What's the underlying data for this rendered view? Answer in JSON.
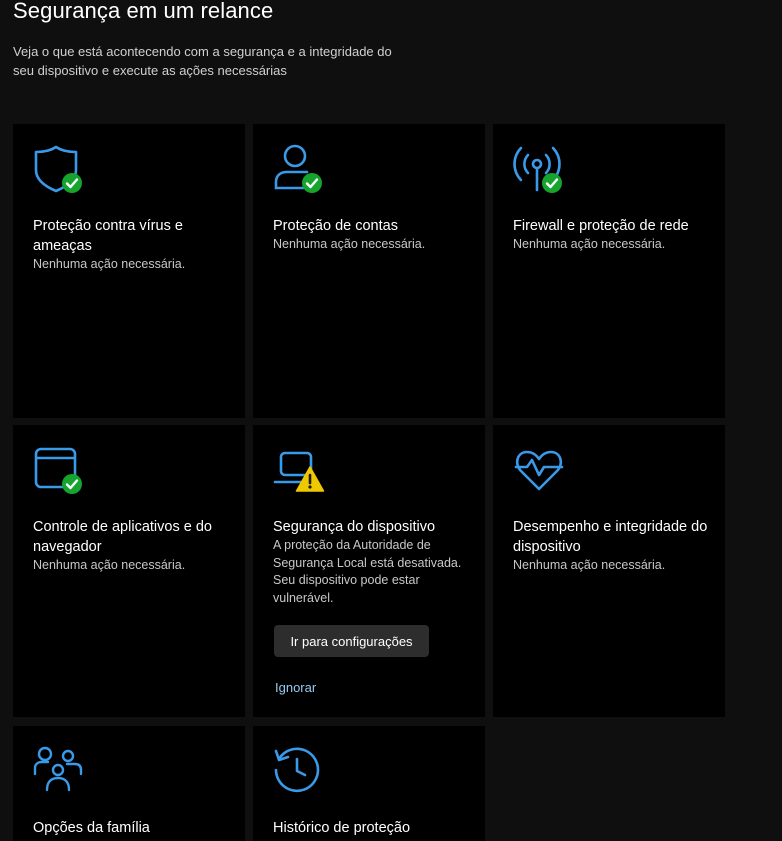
{
  "page": {
    "title": "Segurança em um relance",
    "subtitle": "Veja o que está acontecendo com a segurança e a integridade do seu dispositivo e execute as ações necessárias"
  },
  "colors": {
    "accent": "#3a9ae8",
    "ok_badge": "#16a32e",
    "warning": "#f0c800",
    "link": "#99c9ef",
    "tile_bg": "#000000",
    "page_bg": "#0f0f0f"
  },
  "tiles": [
    {
      "name": "Proteção contra vírus e ameaças",
      "status": "Nenhuma ação necessária.",
      "icon": "shield-icon",
      "badge": "ok"
    },
    {
      "name": "Proteção de contas",
      "status": "Nenhuma ação necessária.",
      "icon": "person-icon",
      "badge": "ok"
    },
    {
      "name": "Firewall e proteção de rede",
      "status": "Nenhuma ação necessária.",
      "icon": "wifi-antenna-icon",
      "badge": "ok"
    },
    {
      "name": "Controle de aplicativos e do navegador",
      "status": "Nenhuma ação necessária.",
      "icon": "browser-window-icon",
      "badge": "ok"
    },
    {
      "name": "Segurança do dispositivo",
      "status": "A proteção da Autoridade de Segurança Local está desativada. Seu dispositivo pode estar vulnerável.",
      "icon": "laptop-icon",
      "badge": "warning",
      "button_label": "Ir para configurações",
      "link_label": "Ignorar"
    },
    {
      "name": "Desempenho e integridade do dispositivo",
      "status": "Nenhuma ação necessária.",
      "icon": "heart-pulse-icon",
      "badge": "none"
    },
    {
      "name": "Opções da família",
      "status": "",
      "icon": "family-icon",
      "badge": "none"
    },
    {
      "name": "Histórico de proteção",
      "status": "",
      "icon": "history-clock-icon",
      "badge": "none"
    }
  ]
}
